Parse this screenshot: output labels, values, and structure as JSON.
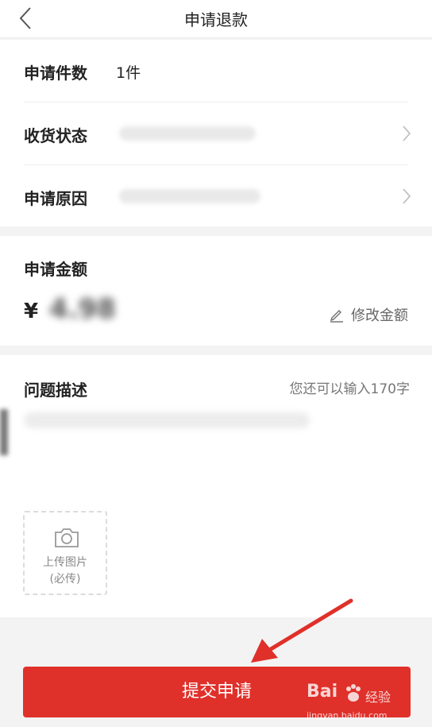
{
  "header": {
    "title": "申请退款",
    "back_icon": "chevron-left-icon"
  },
  "form": {
    "quantity": {
      "label": "申请件数",
      "value": "1件"
    },
    "receipt_status": {
      "label": "收货状态",
      "icon": "chevron-right-icon"
    },
    "reason": {
      "label": "申请原因",
      "icon": "chevron-right-icon"
    }
  },
  "amount": {
    "label": "申请金额",
    "currency": "¥",
    "value": "4.98",
    "edit_label": "修改金额",
    "edit_icon": "pencil-icon"
  },
  "description": {
    "label": "问题描述",
    "counter": "您还可以输入170字"
  },
  "upload": {
    "line1": "上传图片",
    "line2": "(必传)",
    "icon": "camera-icon"
  },
  "submit_label": "提交申请",
  "colors": {
    "primary": "#e0302a",
    "background": "#f3f3f3",
    "arrow": "#e0302a"
  },
  "watermark": {
    "brand": "Bai",
    "suffix": "经验",
    "url": "jingyan.baidu.com"
  }
}
